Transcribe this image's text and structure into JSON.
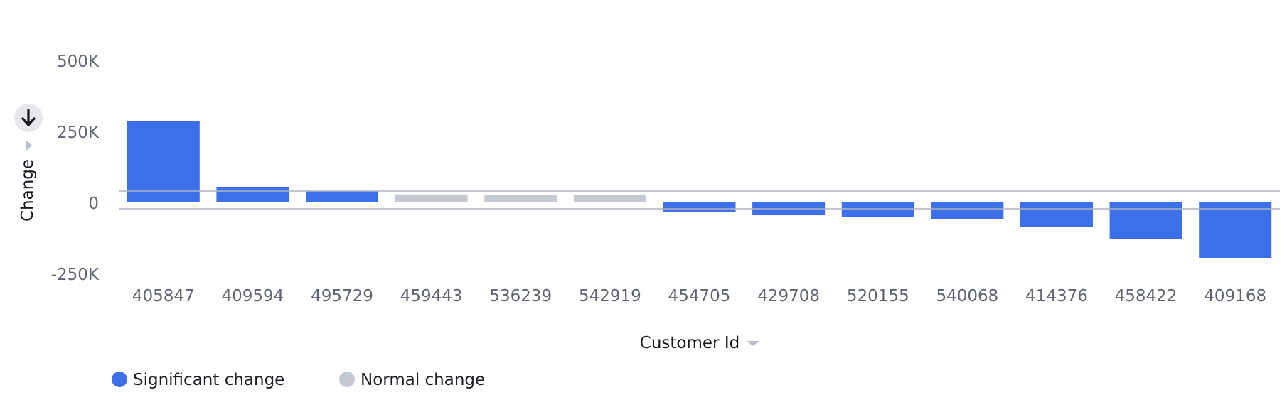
{
  "chart_data": {
    "type": "bar",
    "xlabel": "Customer Id",
    "ylabel": "Change",
    "ylim": [
      -250000,
      500000
    ],
    "y_ticks": [
      {
        "value": 500000,
        "label": "500K"
      },
      {
        "value": 250000,
        "label": "250K"
      },
      {
        "value": 0,
        "label": "0"
      },
      {
        "value": -250000,
        "label": "-250K"
      }
    ],
    "categories": [
      "405847",
      "409594",
      "495729",
      "459443",
      "536239",
      "542919",
      "454705",
      "429708",
      "520155",
      "540068",
      "414376",
      "458422",
      "409168"
    ],
    "values": [
      285000,
      55000,
      40000,
      28000,
      27000,
      25000,
      -35000,
      -45000,
      -50000,
      -60000,
      -85000,
      -130000,
      -195000
    ],
    "groups": [
      "Significant change",
      "Significant change",
      "Significant change",
      "Normal change",
      "Normal change",
      "Normal change",
      "Significant change",
      "Significant change",
      "Significant change",
      "Significant change",
      "Significant change",
      "Significant change",
      "Significant change"
    ],
    "legend": {
      "position": "bottom-left",
      "entries": [
        {
          "name": "Significant change",
          "color": "#3d6fe8"
        },
        {
          "name": "Normal change",
          "color": "#c3c8d1"
        }
      ]
    },
    "grid": false
  },
  "controls": {
    "sort_icon": "arrow-down-icon",
    "expand_icon": "caret-right-icon",
    "x_axis_menu_icon": "caret-down-icon"
  }
}
